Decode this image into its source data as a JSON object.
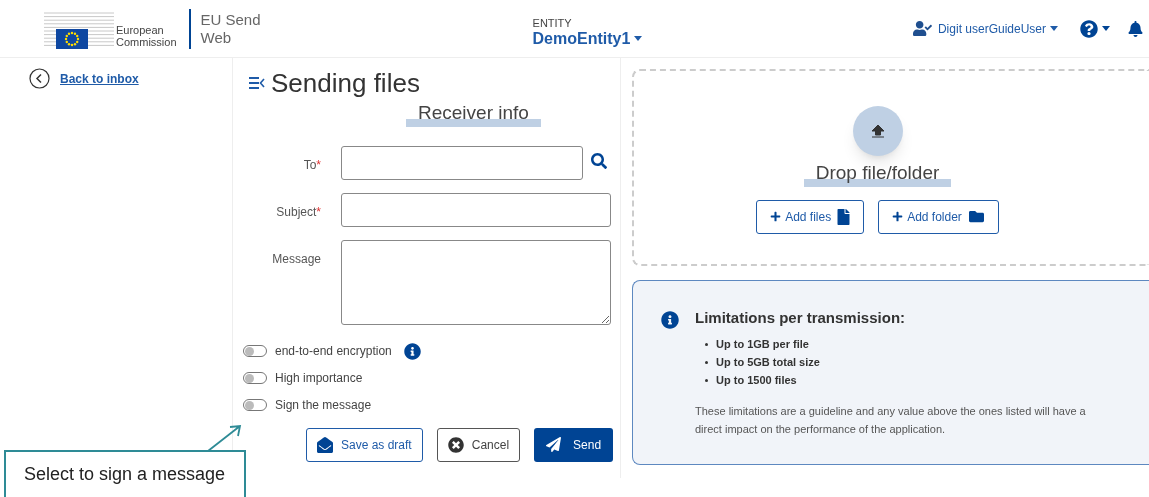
{
  "header": {
    "org_name": [
      "European",
      "Commission"
    ],
    "app_name": [
      "EU Send",
      "Web"
    ],
    "entity_label": "ENTITY",
    "entity_name": "DemoEntity1",
    "user_name": "Digit userGuideUser"
  },
  "sidebar": {
    "back_link": "Back to inbox"
  },
  "form": {
    "title": "Sending files",
    "section_title": "Receiver info",
    "section_highlighted": true,
    "fields": [
      {
        "kind": "input",
        "label": "To",
        "required_mark": "*",
        "search": true
      },
      {
        "kind": "input",
        "label": "Subject",
        "required_mark": "*",
        "search": false
      },
      {
        "kind": "textarea",
        "label": "Message",
        "search": false
      }
    ],
    "toggles": [
      {
        "label": "end-to-end encryption",
        "on": false,
        "info": true
      },
      {
        "label": "High importance",
        "on": false,
        "info": false
      },
      {
        "label": "Sign the message",
        "on": false,
        "info": false
      }
    ],
    "buttons": [
      {
        "kind": "draft",
        "label": "Save as draft"
      },
      {
        "kind": "cancel",
        "label": "Cancel"
      },
      {
        "kind": "send",
        "label": "Send"
      }
    ]
  },
  "dropzone": {
    "title": "Drop file/folder",
    "title_highlighted": true,
    "buttons": [
      {
        "kind": "files",
        "label": "Add files"
      },
      {
        "kind": "folder",
        "label": "Add folder"
      }
    ]
  },
  "limits": {
    "title": "Limitations per transmission:",
    "items": [
      "Up to 1GB per file",
      "Up to 5GB total size",
      "Up to 1500 files"
    ],
    "note": "These limitations are a guideline and any value above the ones listed will have a direct impact on the performance of the application."
  },
  "callout": {
    "text": "Select to sign a message"
  }
}
